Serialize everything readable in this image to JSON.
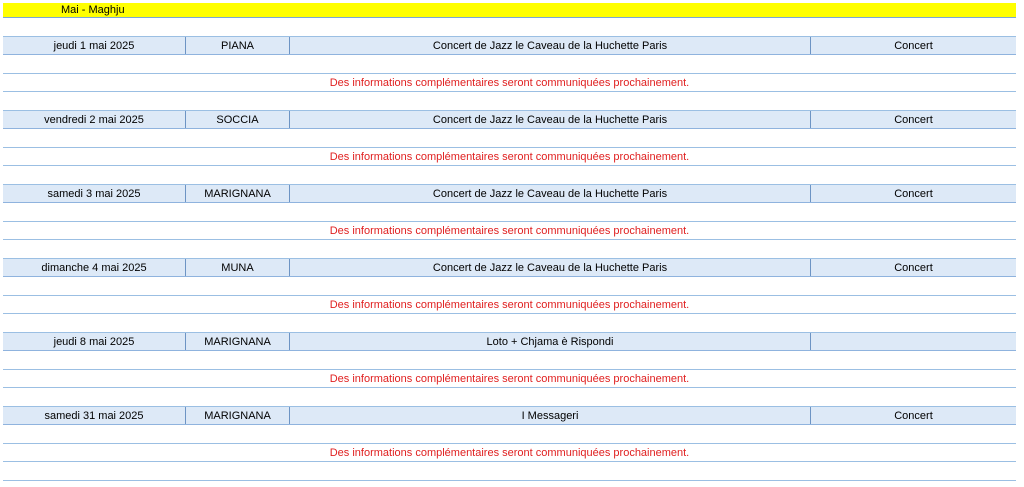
{
  "month_title": "Mai - Maghju",
  "events": [
    {
      "date": "jeudi 1 mai 2025",
      "place": "PIANA",
      "title": "Concert de Jazz le Caveau de la Huchette Paris",
      "type": "Concert",
      "info": "Des informations complémentaires seront communiquées prochainement."
    },
    {
      "date": "vendredi 2 mai 2025",
      "place": "SOCCIA",
      "title": "Concert de Jazz le Caveau de la Huchette Paris",
      "type": "Concert",
      "info": "Des informations complémentaires seront communiquées prochainement."
    },
    {
      "date": "samedi 3 mai 2025",
      "place": "MARIGNANA",
      "title": "Concert de Jazz le Caveau de la Huchette Paris",
      "type": "Concert",
      "info": "Des informations complémentaires seront communiquées prochainement."
    },
    {
      "date": "dimanche 4 mai 2025",
      "place": "MUNA",
      "title": "Concert de Jazz le Caveau de la Huchette Paris",
      "type": "Concert",
      "info": "Des informations complémentaires seront communiquées prochainement."
    },
    {
      "date": "jeudi 8 mai 2025",
      "place": "MARIGNANA",
      "title": "Loto + Chjama è Rispondi",
      "type": "",
      "info": "Des informations complémentaires seront communiquées prochainement."
    },
    {
      "date": "samedi 31 mai 2025",
      "place": "MARIGNANA",
      "title": "I Messageri",
      "type": "Concert",
      "info": "Des informations complémentaires seront communiquées prochainement."
    }
  ],
  "colors": {
    "header_bg": "#ffff00",
    "row_bg": "#dde9f7",
    "info_text": "#e02020"
  }
}
